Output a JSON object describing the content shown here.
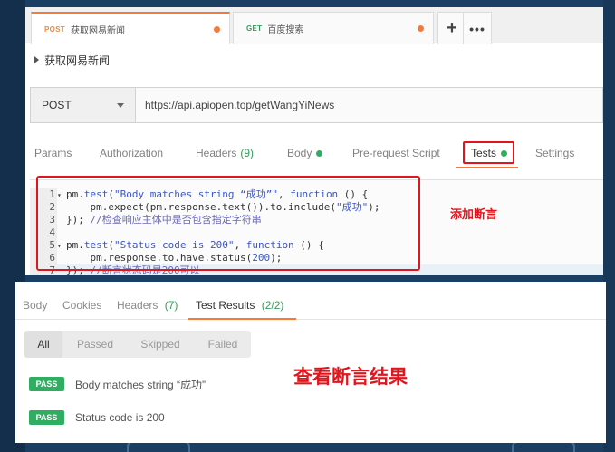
{
  "tabs": [
    {
      "method": "POST",
      "title": "获取网易新闻",
      "active": true
    },
    {
      "method": "GET",
      "title": "百度搜索",
      "active": false
    }
  ],
  "tab_controls": {
    "add": "+",
    "more": "•••"
  },
  "request": {
    "name": "获取网易新闻",
    "method": "POST",
    "url": "https://api.apiopen.top/getWangYiNews"
  },
  "request_tabs": [
    {
      "label": "Params"
    },
    {
      "label": "Authorization"
    },
    {
      "label": "Headers",
      "count": "(9)"
    },
    {
      "label": "Body"
    },
    {
      "label": "Pre-request Script"
    },
    {
      "label": "Tests"
    },
    {
      "label": "Settings"
    }
  ],
  "code": {
    "line_numbers": [
      "1",
      "2",
      "3",
      "4",
      "5",
      "6",
      "7"
    ],
    "l1": {
      "a": "pm.",
      "b": "test",
      "c": "(",
      "d": "\"Body matches string “成功”\"",
      "e": ", ",
      "f": "function",
      "g": " () {"
    },
    "l2": {
      "a": "    pm.expect(pm.response.text()).to.include(",
      "b": "\"成功\"",
      "c": ");"
    },
    "l3": {
      "a": "}); ",
      "b": "//检查响应主体中是否包含指定字符串"
    },
    "l5": {
      "a": "pm.",
      "b": "test",
      "c": "(",
      "d": "\"Status code is 200\"",
      "e": ", ",
      "f": "function",
      "g": " () {"
    },
    "l6": {
      "a": "    pm.response.to.have.status(",
      "b": "200",
      "c": ");"
    },
    "l7": {
      "a": "}); ",
      "b": "//断言状态码是200可以"
    }
  },
  "annotations": {
    "add_assertion": "添加断言",
    "view_results": "查看断言结果"
  },
  "response_tabs": [
    {
      "label": "Body"
    },
    {
      "label": "Cookies"
    },
    {
      "label": "Headers",
      "count": "(7)"
    },
    {
      "label": "Test Results",
      "count": "(2/2)"
    }
  ],
  "filters": [
    "All",
    "Passed",
    "Skipped",
    "Failed"
  ],
  "results": [
    {
      "status": "PASS",
      "name": "Body matches string “成功”"
    },
    {
      "status": "PASS",
      "name": "Status code is 200"
    }
  ],
  "colors": {
    "accent": "#f47a3a",
    "pass": "#2fae62",
    "annotation": "#e0161e",
    "background": "#1b3f63"
  }
}
